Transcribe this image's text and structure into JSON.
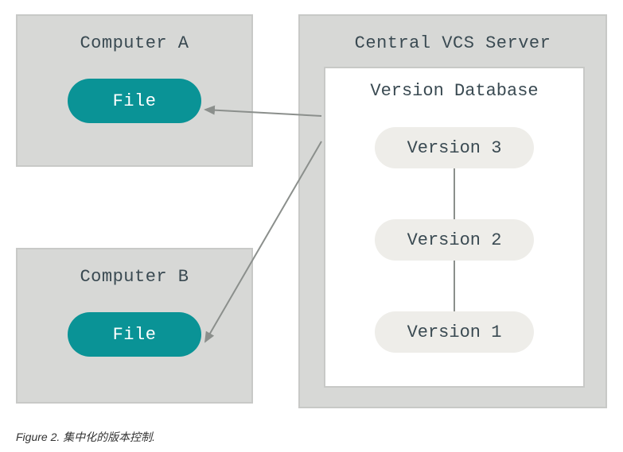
{
  "computer_a": {
    "title": "Computer A",
    "file_label": "File"
  },
  "computer_b": {
    "title": "Computer B",
    "file_label": "File"
  },
  "server": {
    "title": "Central VCS Server",
    "database": {
      "title": "Version Database",
      "versions": [
        "Version 3",
        "Version 2",
        "Version 1"
      ]
    }
  },
  "caption": "Figure 2. 集中化的版本控制."
}
